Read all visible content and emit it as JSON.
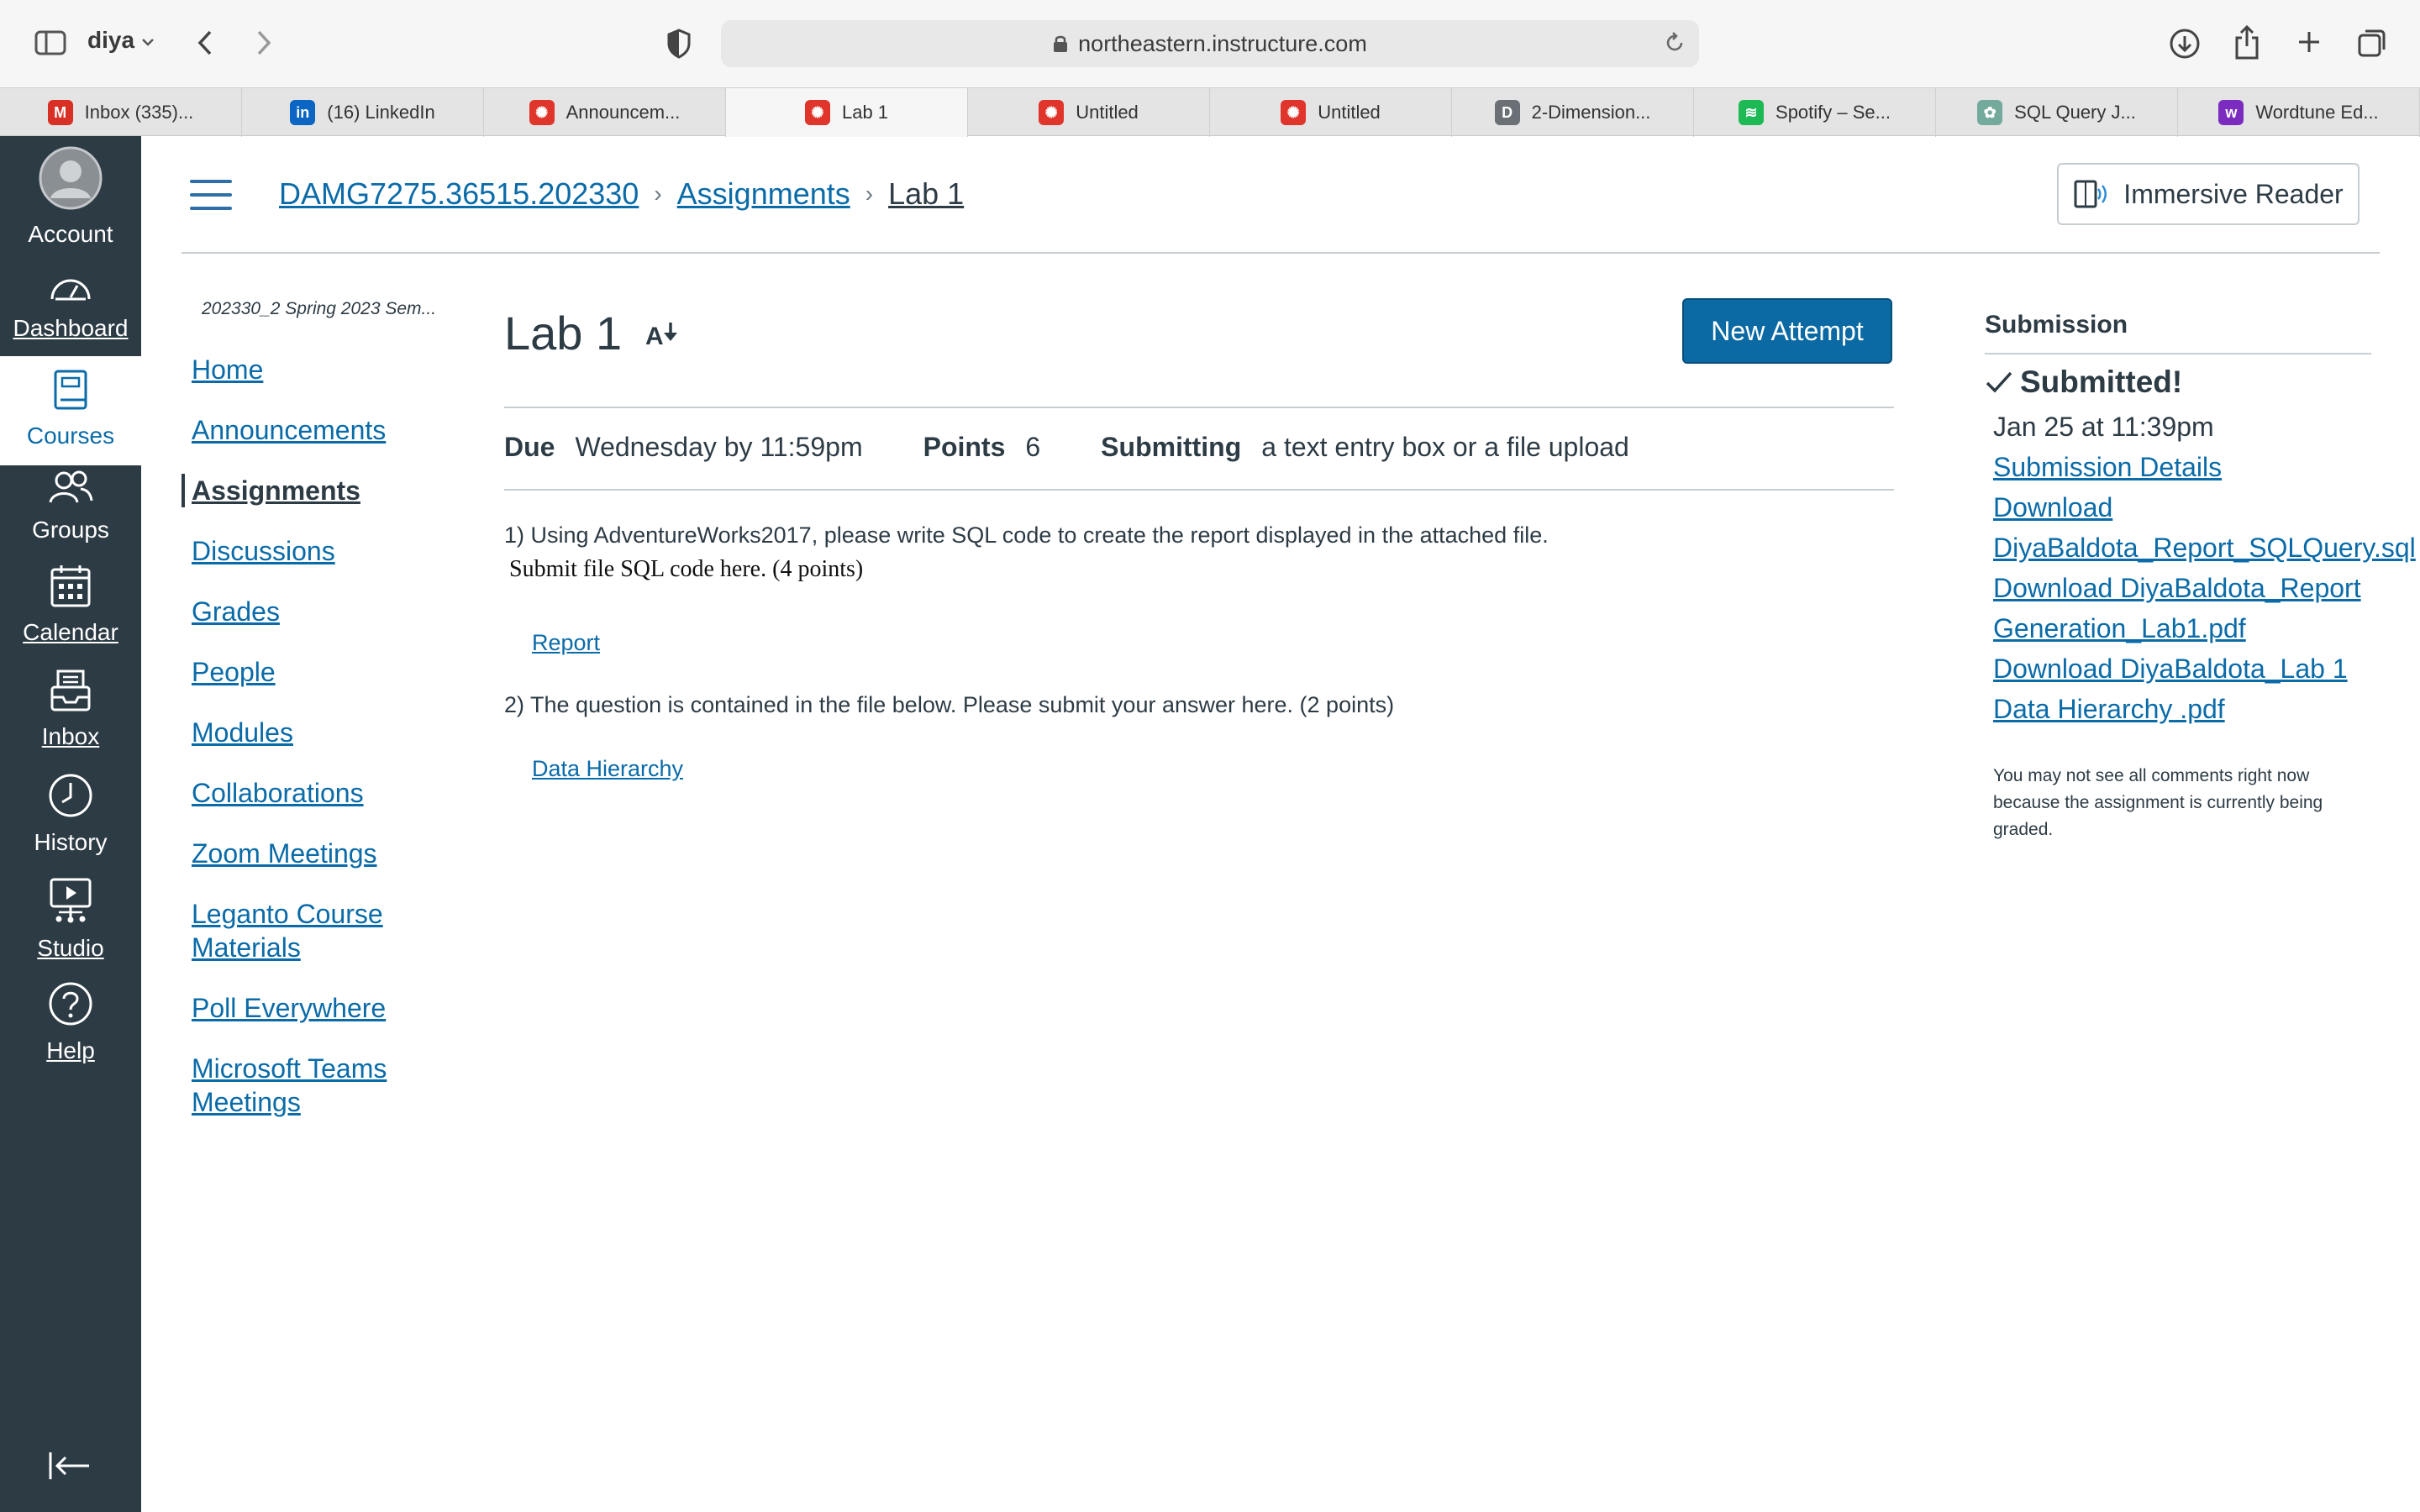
{
  "browser": {
    "profile": "diya",
    "url": "northeastern.instructure.com",
    "tabs": [
      {
        "label": "Inbox (335)...",
        "icon": "gmail-icon",
        "color": "#d93025",
        "glyph": "M",
        "active": false
      },
      {
        "label": "(16) LinkedIn",
        "icon": "linkedin-icon",
        "color": "#0a66c2",
        "glyph": "in",
        "active": false
      },
      {
        "label": "Announcem...",
        "icon": "canvas-icon",
        "color": "#e0352b",
        "glyph": "✺",
        "active": false
      },
      {
        "label": "Lab 1",
        "icon": "canvas-icon",
        "color": "#e0352b",
        "glyph": "✺",
        "active": true
      },
      {
        "label": "Untitled",
        "icon": "canvas-icon",
        "color": "#e0352b",
        "glyph": "✺",
        "active": false
      },
      {
        "label": "Untitled",
        "icon": "canvas-icon",
        "color": "#e0352b",
        "glyph": "✺",
        "active": false
      },
      {
        "label": "2-Dimension...",
        "icon": "d-letter-icon",
        "color": "#6b6f76",
        "glyph": "D",
        "active": false
      },
      {
        "label": "Spotify – Se...",
        "icon": "spotify-icon",
        "color": "#1db954",
        "glyph": "≋",
        "active": false
      },
      {
        "label": "SQL Query J...",
        "icon": "chatgpt-icon",
        "color": "#74aa9c",
        "glyph": "✿",
        "active": false
      },
      {
        "label": "Wordtune Ed...",
        "icon": "wordtune-icon",
        "color": "#7b2cbf",
        "glyph": "w",
        "active": false
      }
    ]
  },
  "global_nav": {
    "account": "Account",
    "dashboard": "Dashboard",
    "courses": "Courses",
    "groups": "Groups",
    "calendar": "Calendar",
    "inbox": "Inbox",
    "history": "History",
    "studio": "Studio",
    "help": "Help"
  },
  "header": {
    "breadcrumb": [
      "DAMG7275.36515.202330",
      "Assignments",
      "Lab 1"
    ],
    "immersive_reader": "Immersive Reader"
  },
  "course_nav": {
    "term": "202330_2 Spring 2023 Sem...",
    "items": [
      {
        "label": "Home"
      },
      {
        "label": "Announcements"
      },
      {
        "label": "Assignments"
      },
      {
        "label": "Discussions"
      },
      {
        "label": "Grades"
      },
      {
        "label": "People"
      },
      {
        "label": "Modules"
      },
      {
        "label": "Collaborations"
      },
      {
        "label": "Zoom Meetings"
      },
      {
        "label": "Leganto Course Materials"
      },
      {
        "label": "Poll Everywhere"
      },
      {
        "label": "Microsoft Teams Meetings"
      }
    ],
    "active_index": 2
  },
  "assignment": {
    "title": "Lab 1",
    "new_attempt": "New Attempt",
    "due_label": "Due",
    "due_value": "Wednesday by 11:59pm",
    "points_label": "Points",
    "points_value": "6",
    "submitting_label": "Submitting",
    "submitting_value": "a text entry box or a file upload",
    "q1": "1) Using AdventureWorks2017, please write SQL code to create the report displayed in the attached file.",
    "q1b": "Submit file SQL code here. (4 points)",
    "report_link": "Report",
    "q2": "2) The question is contained in the file below. Please submit your answer here. (2 points)",
    "data_hierarchy_link": "Data Hierarchy"
  },
  "submission": {
    "heading": "Submission",
    "status": "Submitted!",
    "date": "Jan 25 at 11:39pm",
    "links": [
      "Submission Details",
      "Download",
      "DiyaBaldota_Report_SQLQuery.sql",
      "Download DiyaBaldota_Report",
      "Generation_Lab1.pdf",
      "Download DiyaBaldota_Lab 1",
      "Data Hierarchy .pdf"
    ],
    "note": "You may not see all comments right now because the assignment is currently being graded."
  }
}
